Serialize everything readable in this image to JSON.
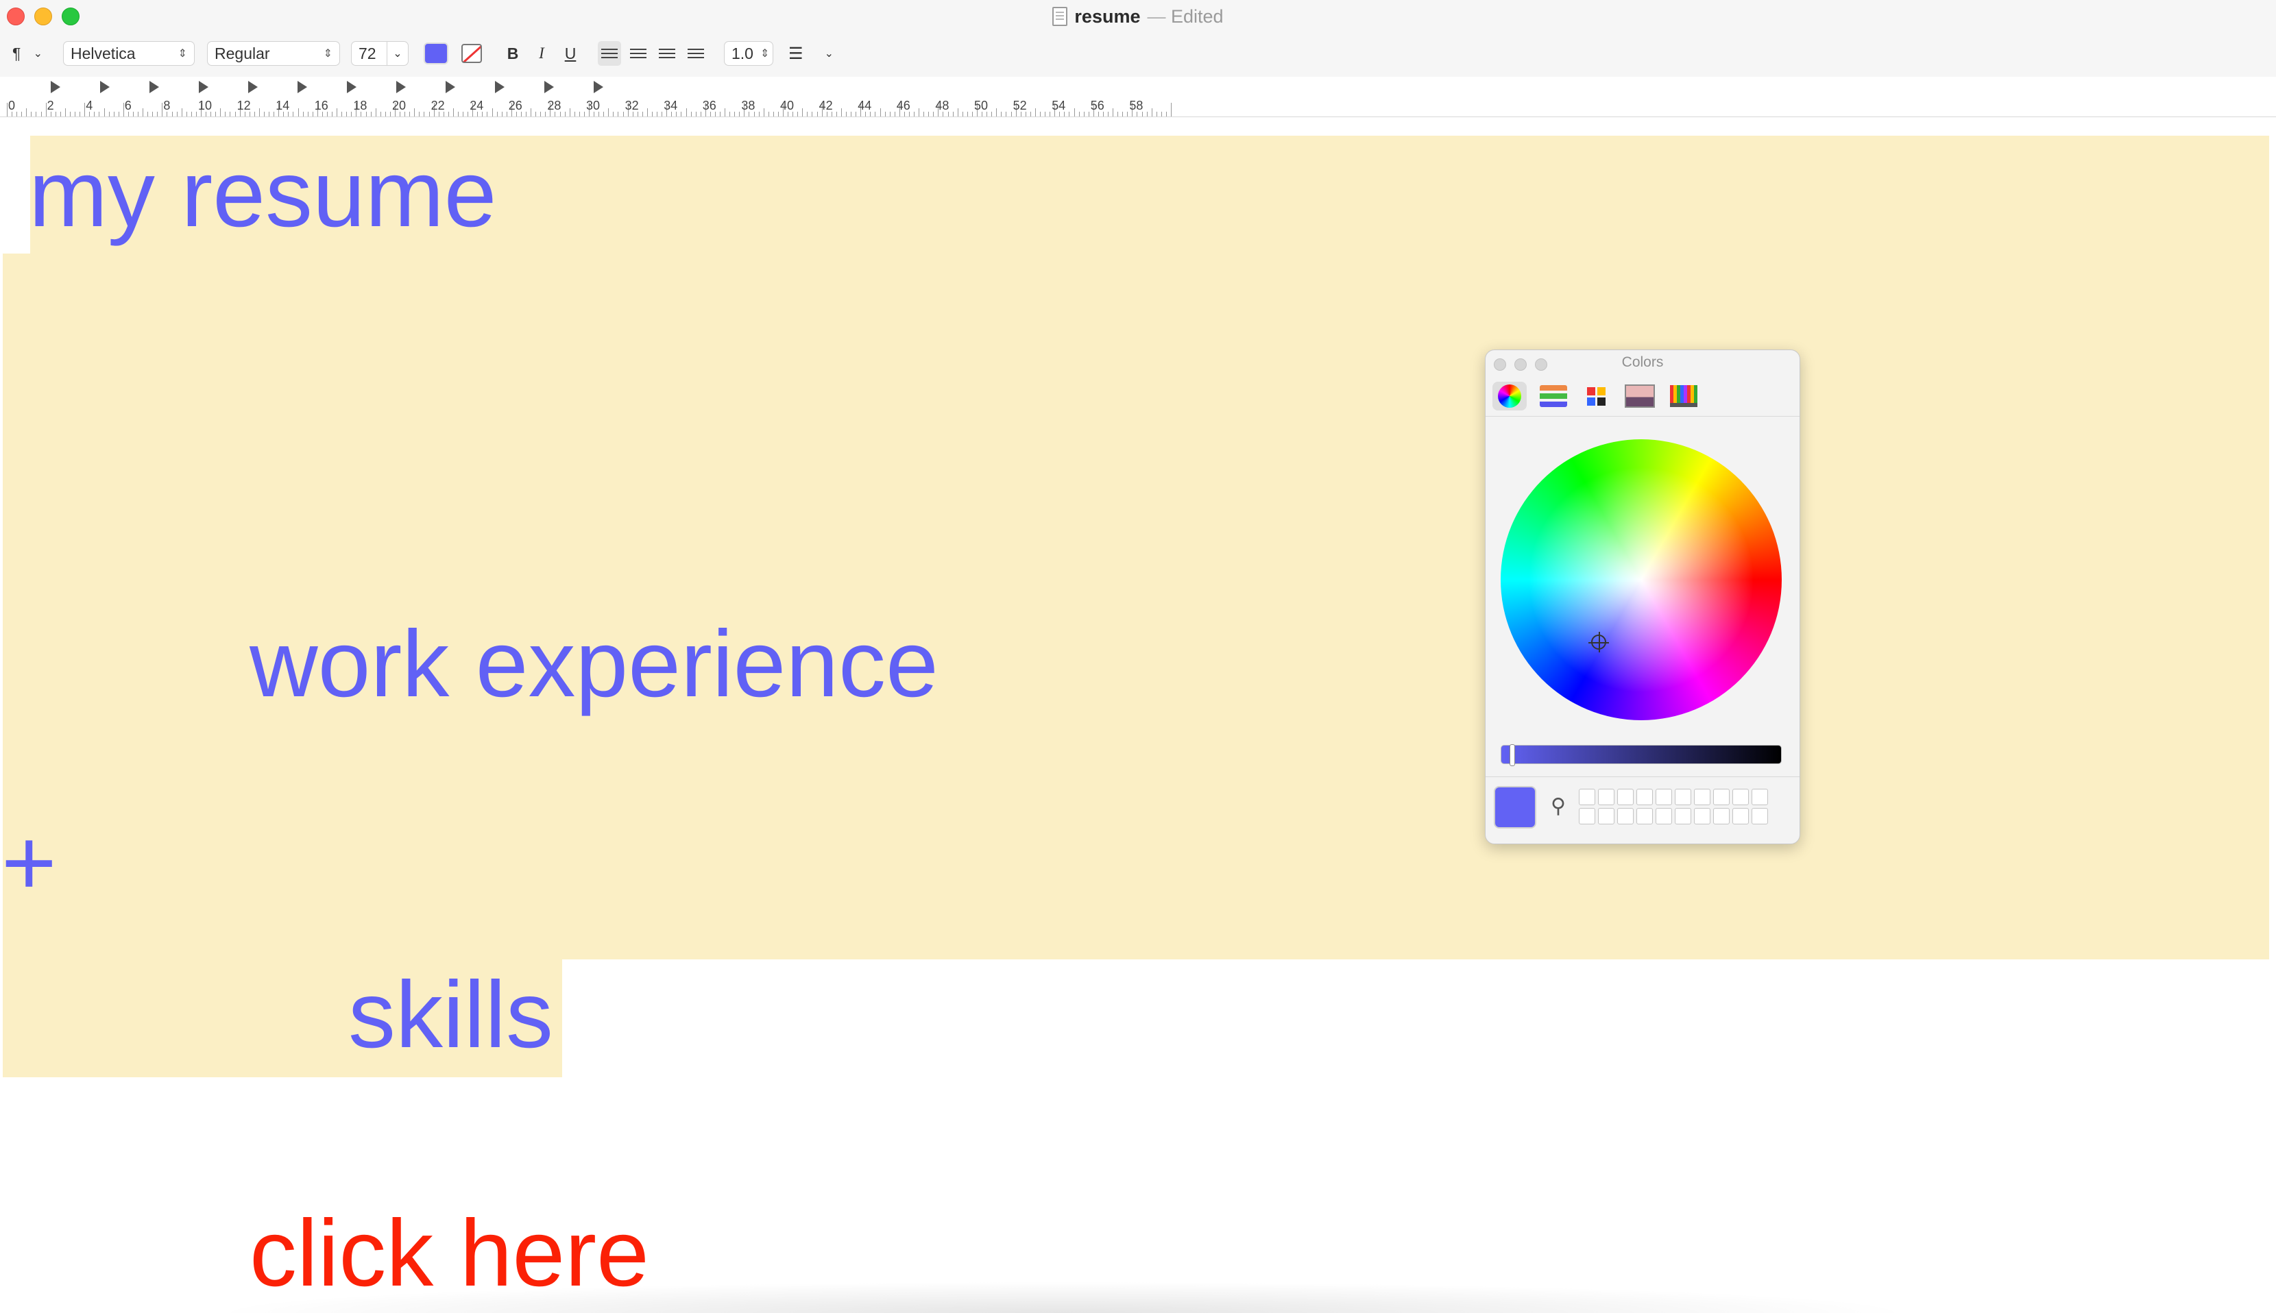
{
  "window": {
    "title": "resume",
    "separator": "—",
    "status": "Edited"
  },
  "toolbar": {
    "paragraph_symbol": "¶",
    "font_family": "Helvetica",
    "font_style": "Regular",
    "font_size": "72",
    "text_color": "#6161f5",
    "bold_label": "B",
    "italic_label": "I",
    "underline_label": "U",
    "line_spacing": "1.0",
    "list_icon": "list-bullets-icon"
  },
  "ruler": {
    "labels": [
      "0",
      "2",
      "4",
      "6",
      "8",
      "10",
      "12",
      "14",
      "16",
      "18",
      "20",
      "22",
      "24",
      "26",
      "28",
      "30",
      "32",
      "34",
      "36",
      "38",
      "40",
      "42",
      "44",
      "46",
      "48",
      "50",
      "52",
      "54",
      "56",
      "58"
    ]
  },
  "document": {
    "heading": "my resume",
    "section_1": "work experience",
    "plus_sign": "+",
    "section_2": "skills",
    "link_text": "click here",
    "highlight_color": "#fbefc5",
    "body_color": "#6161f5",
    "link_color": "#fb2106"
  },
  "colors_panel": {
    "title": "Colors",
    "modes": [
      "color-wheel-icon",
      "color-sliders-icon",
      "color-palettes-icon",
      "image-palettes-icon",
      "pencils-icon"
    ],
    "selected_color": "#6262f4",
    "eyedropper_icon": "eyedropper-icon"
  }
}
